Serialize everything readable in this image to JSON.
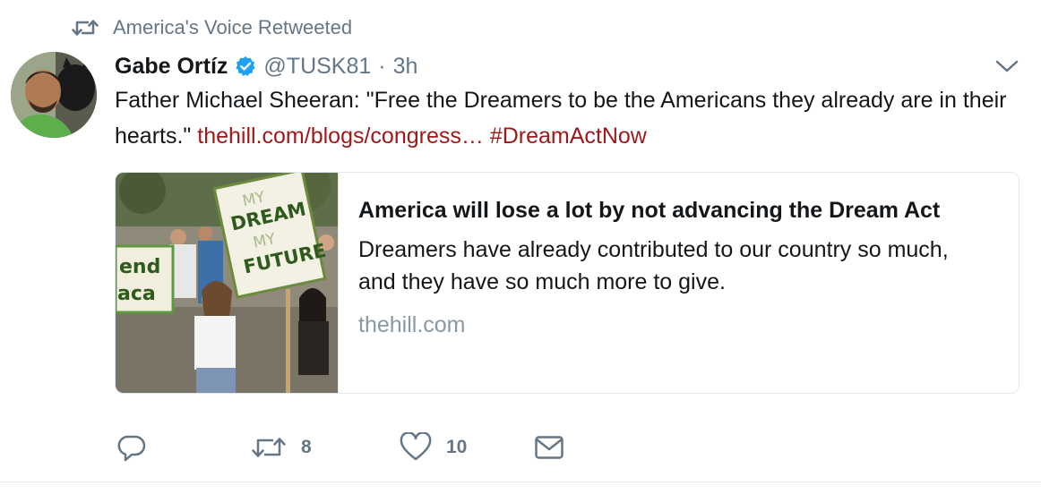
{
  "retweet_context": {
    "text": "America's Voice Retweeted"
  },
  "tweet": {
    "author_name": "Gabe Ortíz",
    "author_handle": "@TUSK81",
    "separator": "·",
    "timestamp": "3h",
    "text_main": "Father Michael Sheeran: \"Free the Dreamers to be the Americans they already are in their hearts.\"",
    "link_text": "thehill.com/blogs/congress…",
    "hashtag": "#DreamActNow"
  },
  "card": {
    "title": "America will lose a lot by not advancing the Dream Act",
    "description": "Dreamers have already contributed to our country so much, and they have so much more to give.",
    "domain": "thehill.com",
    "image_sign_text_1": "MY DREAM MY FUTURE",
    "image_sign_text_2": "end daca"
  },
  "actions": {
    "reply_count": "",
    "retweet_count": "8",
    "like_count": "10"
  },
  "icons": {
    "retweet_context": "retweet-icon",
    "verified": "verified-badge-icon",
    "caret": "chevron-down-icon",
    "reply": "reply-icon",
    "retweet": "retweet-icon",
    "like": "heart-icon",
    "dm": "envelope-icon"
  },
  "colors": {
    "link": "#a0191a",
    "secondary_text": "#657786",
    "verified": "#1da1f2",
    "domain": "#8899a6"
  }
}
